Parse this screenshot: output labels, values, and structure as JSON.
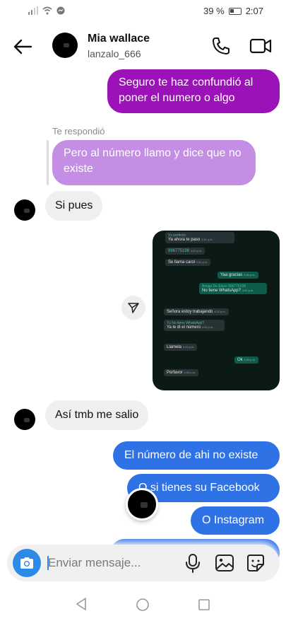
{
  "status_bar": {
    "battery": "39 %",
    "time": "2:07"
  },
  "header": {
    "name": "Mia wallace",
    "username": "lanzalo_666"
  },
  "messages": [
    {
      "text": "Seguro te haz confundió al poner el numero o algo",
      "side": "out"
    },
    {
      "reply_label": "Te respondió",
      "text": "Pero al número llamo y dice que no existe",
      "side": "reply"
    },
    {
      "text": "Si pues",
      "side": "in"
    },
    {
      "text": "Así tmb me salio",
      "side": "in"
    },
    {
      "text": "El número de ahi no existe",
      "side": "out"
    },
    {
      "text": "O si tienes su Facebook",
      "side": "out"
    },
    {
      "text": "O Instagram",
      "side": "out"
    }
  ],
  "screenshot": {
    "bubbles": [
      {
        "text": "Vs perfecto",
        "side": "quote"
      },
      {
        "text": "Ya ahora te paso",
        "time": "4:31 p.m.",
        "side": "in"
      },
      {
        "text": "996775198",
        "time": "4:29 p.m.",
        "side": "in",
        "accent": true
      },
      {
        "text": "Se llama carol",
        "time": "4:31 p.m.",
        "side": "in"
      },
      {
        "text": "Yaa gracias",
        "time": "4:36 p.m.",
        "side": "out"
      },
      {
        "text": "Amiga De Ekiso 996775198",
        "side": "quote"
      },
      {
        "text": "No tiene WhatsApp?",
        "time": "4:32 p.m.",
        "side": "out"
      },
      {
        "text": "Señora estoy trabajando",
        "time": "4:32 p.m.",
        "side": "in"
      },
      {
        "text": "Tú  No tiene WhatsApp?",
        "side": "quote"
      },
      {
        "text": "Ya le di el número",
        "time": "4:33 p.m.",
        "side": "in"
      },
      {
        "text": "Llamela",
        "time": "4:33 p.m.",
        "side": "in"
      },
      {
        "text": "Ok",
        "time": "4:33 p.m.",
        "side": "out"
      },
      {
        "text": "Porfavor",
        "time": "4:33 p.m.",
        "side": "in"
      }
    ]
  },
  "composer": {
    "placeholder": "Enviar mensaje..."
  },
  "colors": {
    "sent_purple": "#9b13b8",
    "reply_lavender": "#c48ee4",
    "sent_blue": "#2f72e6",
    "received_gray": "#efefef",
    "camera_blue": "#2c8be6"
  }
}
